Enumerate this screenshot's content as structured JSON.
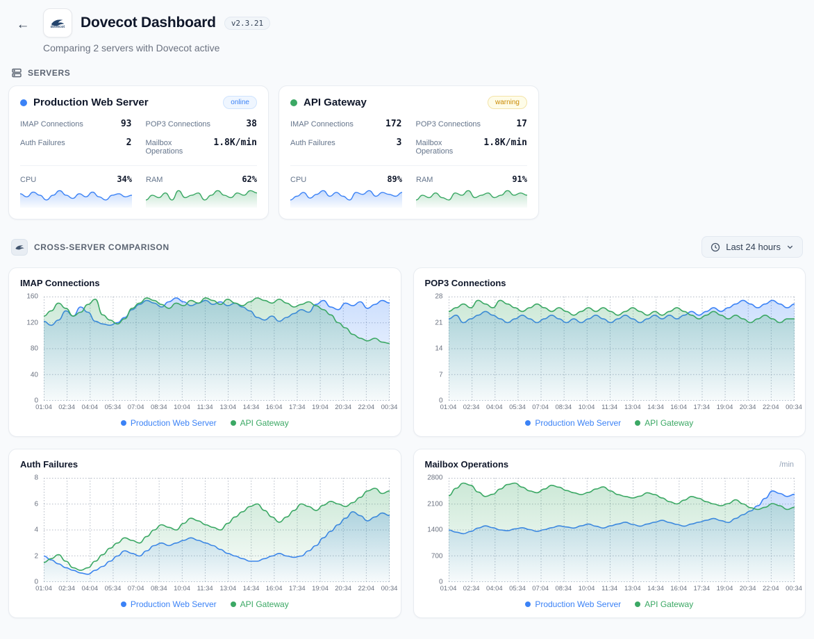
{
  "header": {
    "back": "←",
    "logo_text": "dovecot",
    "title": "Dovecot Dashboard",
    "version": "v2.3.21",
    "subtitle": "Comparing 2 servers with Dovecot active"
  },
  "servers": {
    "section_label": "SERVERS",
    "cards": [
      {
        "name": "Production Web Server",
        "dot_color": "#3b82f6",
        "status": "online",
        "status_color": "#3b82f6",
        "stats": [
          {
            "label": "IMAP Connections",
            "value": "93"
          },
          {
            "label": "POP3 Connections",
            "value": "38"
          },
          {
            "label": "Auth Failures",
            "value": "2"
          },
          {
            "label": "Mailbox Operations",
            "value": "1.8K/min"
          }
        ],
        "gauges": [
          {
            "label": "CPU",
            "value": "34%",
            "color": "#3b82f6",
            "spark": [
              35,
              33,
              36,
              34,
              31,
              34,
              37,
              34,
              32,
              35,
              33,
              36,
              33,
              31,
              34,
              35,
              33,
              34
            ]
          },
          {
            "label": "RAM",
            "value": "62%",
            "color": "#3ba864",
            "spark": [
              60,
              62,
              61,
              63,
              60,
              64,
              61,
              62,
              63,
              60,
              62,
              64,
              62,
              61,
              63,
              62,
              64,
              63
            ]
          }
        ]
      },
      {
        "name": "API Gateway",
        "dot_color": "#3ba864",
        "status": "warning",
        "status_color": "#ca8a04",
        "stats": [
          {
            "label": "IMAP Connections",
            "value": "172"
          },
          {
            "label": "POP3 Connections",
            "value": "17"
          },
          {
            "label": "Auth Failures",
            "value": "3"
          },
          {
            "label": "Mailbox Operations",
            "value": "1.8K/min"
          }
        ],
        "gauges": [
          {
            "label": "CPU",
            "value": "89%",
            "color": "#3b82f6",
            "spark": [
              86,
              88,
              90,
              87,
              89,
              91,
              88,
              90,
              88,
              86,
              90,
              89,
              91,
              88,
              90,
              89,
              88,
              90
            ]
          },
          {
            "label": "RAM",
            "value": "91%",
            "color": "#3ba864",
            "spark": [
              89,
              91,
              90,
              92,
              90,
              89,
              92,
              91,
              93,
              90,
              91,
              92,
              90,
              91,
              93,
              91,
              92,
              91
            ]
          }
        ]
      }
    ]
  },
  "comparison": {
    "section_label": "CROSS-SERVER COMPARISON",
    "time_range": "Last 24 hours"
  },
  "chart_data": [
    {
      "type": "line",
      "title": "IMAP Connections",
      "unit": "",
      "grid": "dotted",
      "legend_position": "bottom",
      "ylim": [
        0,
        160
      ],
      "yticks": [
        0,
        40,
        80,
        120,
        160
      ],
      "x": [
        "01:04",
        "02:34",
        "04:04",
        "05:34",
        "07:04",
        "08:34",
        "10:04",
        "11:34",
        "13:04",
        "14:34",
        "16:04",
        "17:34",
        "19:04",
        "20:34",
        "22:04",
        "00:34"
      ],
      "series": [
        {
          "name": "Production Web Server",
          "color": "#3b82f6",
          "values": [
            122,
            116,
            124,
            138,
            130,
            144,
            136,
            122,
            118,
            116,
            120,
            128,
            140,
            148,
            154,
            150,
            144,
            152,
            158,
            152,
            146,
            150,
            154,
            148,
            152,
            146,
            150,
            144,
            138,
            128,
            124,
            130,
            122,
            128,
            134,
            140,
            136,
            148,
            154,
            144,
            140,
            150,
            146,
            152,
            142,
            148,
            154,
            150
          ]
        },
        {
          "name": "API Gateway",
          "color": "#3ba864",
          "values": [
            130,
            138,
            150,
            142,
            130,
            136,
            148,
            156,
            132,
            124,
            118,
            126,
            142,
            150,
            158,
            154,
            148,
            142,
            150,
            146,
            154,
            150,
            158,
            154,
            148,
            156,
            150,
            146,
            152,
            158,
            154,
            150,
            156,
            150,
            144,
            148,
            152,
            146,
            140,
            132,
            120,
            112,
            102,
            96,
            92,
            96,
            90,
            88
          ]
        }
      ]
    },
    {
      "type": "line",
      "title": "POP3 Connections",
      "unit": "",
      "grid": "dotted",
      "legend_position": "bottom",
      "ylim": [
        0,
        28
      ],
      "yticks": [
        0,
        7,
        14,
        21,
        28
      ],
      "x": [
        "01:04",
        "02:34",
        "04:04",
        "05:34",
        "07:04",
        "08:34",
        "10:04",
        "11:34",
        "13:04",
        "14:34",
        "16:04",
        "17:34",
        "19:04",
        "20:34",
        "22:04",
        "00:34"
      ],
      "series": [
        {
          "name": "Production Web Server",
          "color": "#3b82f6",
          "values": [
            22,
            23,
            21,
            22,
            23,
            24,
            23,
            22,
            21,
            22,
            23,
            22,
            21,
            22,
            23,
            22,
            21,
            22,
            21,
            22,
            23,
            22,
            21,
            22,
            23,
            22,
            21,
            22,
            23,
            22,
            23,
            22,
            23,
            24,
            23,
            24,
            25,
            24,
            25,
            26,
            27,
            26,
            25,
            26,
            27,
            26,
            25,
            26
          ]
        },
        {
          "name": "API Gateway",
          "color": "#3ba864",
          "values": [
            24,
            25,
            26,
            25,
            27,
            26,
            25,
            27,
            26,
            25,
            24,
            25,
            26,
            25,
            24,
            25,
            24,
            23,
            24,
            25,
            24,
            25,
            24,
            23,
            24,
            25,
            24,
            23,
            24,
            23,
            24,
            25,
            24,
            23,
            22,
            23,
            24,
            23,
            22,
            23,
            22,
            21,
            22,
            23,
            22,
            21,
            22,
            22
          ]
        }
      ]
    },
    {
      "type": "line",
      "title": "Auth Failures",
      "unit": "",
      "grid": "dotted",
      "legend_position": "bottom",
      "ylim": [
        0,
        8
      ],
      "yticks": [
        0,
        2,
        4,
        6,
        8
      ],
      "x": [
        "01:04",
        "02:34",
        "04:04",
        "05:34",
        "07:04",
        "08:34",
        "10:04",
        "11:34",
        "13:04",
        "14:34",
        "16:04",
        "17:34",
        "19:04",
        "20:34",
        "22:04",
        "00:34"
      ],
      "series": [
        {
          "name": "Production Web Server",
          "color": "#3b82f6",
          "values": [
            2,
            1.7,
            1.4,
            1.1,
            0.9,
            0.7,
            0.6,
            0.9,
            1.2,
            1.6,
            2,
            2.4,
            2.2,
            2,
            2.4,
            2.8,
            3,
            2.8,
            3,
            3.2,
            3.4,
            3.2,
            3,
            2.8,
            2.5,
            2.2,
            2,
            1.8,
            1.6,
            1.6,
            1.8,
            2,
            2.2,
            2,
            1.9,
            2,
            2.4,
            2.8,
            3.4,
            3.9,
            4.4,
            4.9,
            5.4,
            5.1,
            4.7,
            5,
            5.3,
            5.1
          ]
        },
        {
          "name": "API Gateway",
          "color": "#3ba864",
          "values": [
            1.5,
            1.8,
            2.1,
            1.6,
            1.1,
            0.9,
            1.1,
            1.6,
            2.1,
            2.6,
            3,
            3.4,
            3.2,
            3,
            3.5,
            4,
            4.4,
            4.2,
            4,
            4.5,
            4.9,
            4.7,
            4.4,
            4.2,
            4,
            4.5,
            5,
            5.4,
            5.8,
            6,
            5.5,
            5,
            4.6,
            5,
            5.5,
            6,
            5.8,
            5.5,
            5.9,
            6.2,
            6,
            5.8,
            6.1,
            6.5,
            7,
            7.2,
            6.8,
            7
          ]
        }
      ]
    },
    {
      "type": "line",
      "title": "Mailbox Operations",
      "unit": "/min",
      "grid": "dotted",
      "legend_position": "bottom",
      "ylim": [
        0,
        2800
      ],
      "yticks": [
        0,
        700,
        1400,
        2100,
        2800
      ],
      "x": [
        "01:04",
        "02:34",
        "04:04",
        "05:34",
        "07:04",
        "08:34",
        "10:04",
        "11:34",
        "13:04",
        "14:34",
        "16:04",
        "17:34",
        "19:04",
        "20:34",
        "22:04",
        "00:34"
      ],
      "series": [
        {
          "name": "Production Web Server",
          "color": "#3b82f6",
          "values": [
            1400,
            1340,
            1300,
            1360,
            1450,
            1510,
            1460,
            1400,
            1380,
            1430,
            1460,
            1410,
            1360,
            1410,
            1460,
            1510,
            1480,
            1450,
            1510,
            1560,
            1500,
            1450,
            1510,
            1560,
            1610,
            1550,
            1500,
            1560,
            1610,
            1660,
            1600,
            1550,
            1500,
            1560,
            1610,
            1660,
            1710,
            1650,
            1600,
            1710,
            1810,
            1910,
            2050,
            2250,
            2450,
            2380,
            2300,
            2360
          ]
        },
        {
          "name": "API Gateway",
          "color": "#3ba864",
          "values": [
            2320,
            2520,
            2660,
            2600,
            2420,
            2300,
            2360,
            2500,
            2620,
            2660,
            2550,
            2450,
            2400,
            2500,
            2600,
            2550,
            2460,
            2400,
            2350,
            2410,
            2500,
            2560,
            2450,
            2350,
            2300,
            2260,
            2310,
            2400,
            2350,
            2260,
            2160,
            2100,
            2200,
            2300,
            2250,
            2160,
            2100,
            2050,
            2110,
            2210,
            2100,
            2000,
            1950,
            2010,
            2110,
            2050,
            1950,
            2010
          ]
        }
      ]
    }
  ]
}
